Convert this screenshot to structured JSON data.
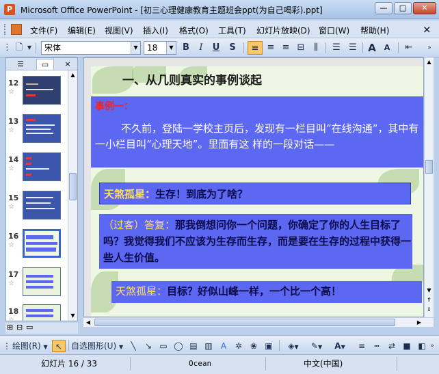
{
  "window": {
    "title": "Microsoft Office PowerPoint - [初三心理健康教育主题班会ppt(为自己喝彩).ppt]",
    "app_icon": "P",
    "minimize": "—",
    "restore": "□",
    "close": "✕"
  },
  "menubar": {
    "items": [
      "文件(F)",
      "编辑(E)",
      "视图(V)",
      "插入(I)",
      "格式(O)",
      "工具(T)",
      "幻灯片放映(D)",
      "窗口(W)",
      "帮助(H)"
    ],
    "close_doc": "×"
  },
  "toolbar": {
    "font_name": "宋体",
    "font_size": "18",
    "bold": "B",
    "italic": "I",
    "underline": "U",
    "shadow": "S",
    "grow_font": "A",
    "shrink_font": "A"
  },
  "outline_panel": {
    "tabs": [
      "outline-tab-icon",
      "slides-tab-icon"
    ],
    "close": "×",
    "slides": [
      {
        "number": "12",
        "star": "☆"
      },
      {
        "number": "13",
        "star": "☆"
      },
      {
        "number": "14",
        "star": "☆"
      },
      {
        "number": "15",
        "star": "☆"
      },
      {
        "number": "16",
        "star": "☆",
        "selected": true
      },
      {
        "number": "17",
        "star": "☆"
      },
      {
        "number": "18",
        "star": "☆"
      }
    ]
  },
  "slide": {
    "heading": "一、从几则真实的事例谈起",
    "example_label": "事例一：",
    "paragraph": "不久前，登陆一学校主页后，发现有一栏目叫“在线沟通”，其中有一小栏目叫“心理天地”。里面有这  样的一段对话——",
    "line1_who": "天煞孤星：",
    "line1_say": "生存！到底为了啥？",
    "line2_who": "（过客）答复：",
    "line2_say": "那我倒想问你一个问题，你确定了你的人生目标了吗？我觉得我们不应该为生存而生存，而是要在生存的过程中获得一些人生价值。",
    "line3_who": "天煞孤星：",
    "line3_say": "目标？好似山峰一样，一个比一个高！"
  },
  "drawbar": {
    "draw_menu": "绘图(R)",
    "autoshapes": "自选图形(U)"
  },
  "statusbar": {
    "slide_pos": "幻灯片 16 / 33",
    "theme": "Ocean",
    "language": "中文(中国)"
  },
  "colors": {
    "slide_box": "#5c67f2",
    "example_red": "#e8262b",
    "speaker_yellow": "#ffe05a"
  }
}
